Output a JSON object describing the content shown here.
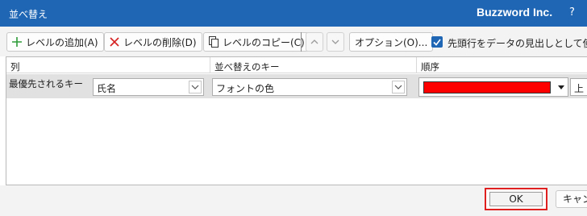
{
  "titlebar": {
    "title": "並べ替え",
    "brand": "Buzzword Inc.",
    "help": "?"
  },
  "toolbar": {
    "add_level": "レベルの追加(A)",
    "delete_level": "レベルの削除(D)",
    "copy_level": "レベルのコピー(C)",
    "options": "オプション(O)...",
    "header_checkbox_label": "先頭行をデータの見出しとして使用す",
    "header_checkbox_checked": true
  },
  "grid": {
    "columns": [
      "列",
      "並べ替えのキー",
      "順序"
    ],
    "row": {
      "label": "最優先されるキー",
      "column_value": "氏名",
      "key_value": "フォントの色",
      "color": "#ff0000",
      "position_value": "上"
    }
  },
  "footer": {
    "ok": "OK",
    "cancel": "キャンセル"
  },
  "colors": {
    "titlebar": "#1f66b4",
    "ok_highlight": "#e02020",
    "selected_color": "#ff0000"
  }
}
